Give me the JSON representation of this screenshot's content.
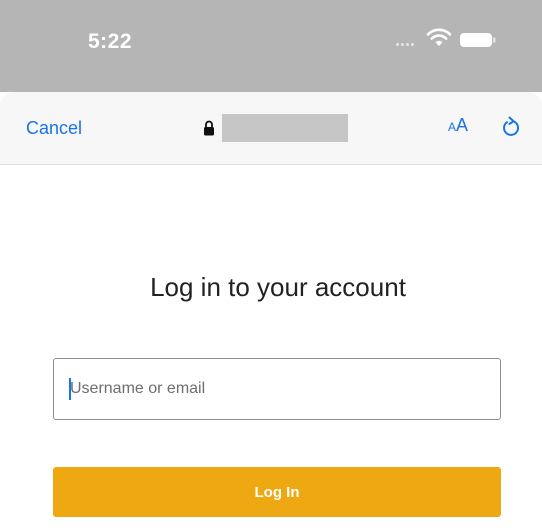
{
  "status_bar": {
    "time": "5:22",
    "icons": [
      "signal-dots-icon",
      "wifi-icon",
      "battery-icon"
    ]
  },
  "browser_bar": {
    "cancel_label": "Cancel",
    "text_size_small": "A",
    "text_size_large": "A",
    "icons": [
      "lock-icon",
      "reload-icon"
    ],
    "accent_color": "#1a73e8"
  },
  "login": {
    "title": "Log in to your account",
    "username_placeholder": "Username or email",
    "username_value": "",
    "submit_label": "Log In",
    "button_color": "#eea912"
  }
}
